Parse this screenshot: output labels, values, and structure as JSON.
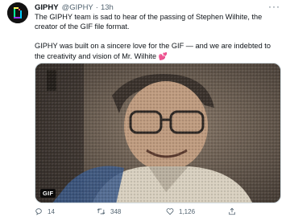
{
  "tweet": {
    "author_name": "GIPHY",
    "author_handle": "@GIPHY",
    "separator": "·",
    "time": "13h",
    "more_label": "···",
    "paragraph1": "The GIPHY team is sad to hear of the passing of Stephen Wilhite, the creator of the GIF file format.",
    "paragraph2": "GIPHY was built on a sincere love for the GIF — and we are indebted to the creativity and vision of Mr. Wilhite",
    "paragraph2_emoji": "💕",
    "media": {
      "badge": "GIF",
      "description_icon": "mosaic-portrait-image"
    },
    "actions": {
      "reply_count": "14",
      "retweet_count": "348",
      "like_count": "1,126",
      "share_count": ""
    }
  },
  "colors": {
    "text": "#0f1419",
    "muted": "#536471",
    "heart": "#e0245e",
    "avatar_bg": "#121212"
  }
}
